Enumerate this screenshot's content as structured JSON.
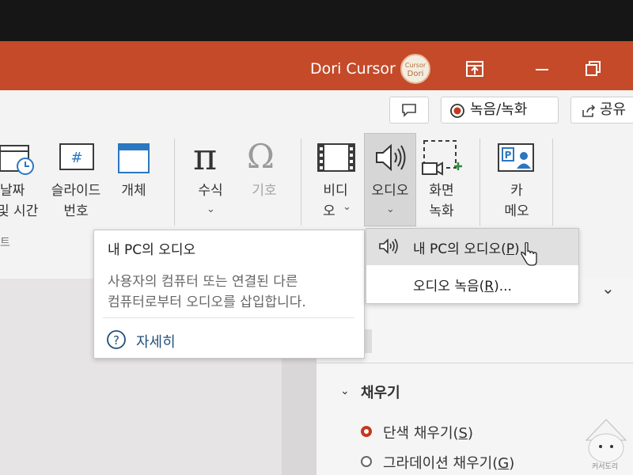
{
  "titlebar": {
    "user_name": "Dori Cursor",
    "avatar_text_line1": "Cursor",
    "avatar_text_line2": "Dori",
    "colors": {
      "titlebar": "#c44a2a",
      "ribbon": "#f3f3f3"
    }
  },
  "ribbon_top": {
    "comment_icon": "comment-icon",
    "record_label": "녹음/녹화",
    "share_label": "공유"
  },
  "ribbon": {
    "datetime": {
      "line1": "날짜",
      "line2": "및 시간"
    },
    "slide_number": {
      "line1": "슬라이드",
      "line2": "번호"
    },
    "object": {
      "label": "개체"
    },
    "equation": {
      "label": "수식"
    },
    "symbol": {
      "label": "기호"
    },
    "video": {
      "line1": "비디",
      "line2": "오"
    },
    "audio": {
      "label": "오디오"
    },
    "screen_recording": {
      "line1": "화면",
      "line2": "녹화"
    },
    "cameo": {
      "line1": "카",
      "line2": "메오"
    },
    "group_label_fragment": "트"
  },
  "tooltip": {
    "title": "내 PC의 오디오",
    "description_line1": "사용자의 컴퓨터 또는 연결된 다른",
    "description_line2": "컴퓨터로부터 오디오를 삽입합니다.",
    "help_label": "자세히"
  },
  "audio_menu": {
    "item1_prefix": "내 PC의 오디오(",
    "item1_key": "P",
    "item1_suffix": ")...",
    "item2_prefix": "오디오 녹음(",
    "item2_key": "R",
    "item2_suffix": ")..."
  },
  "format_pane": {
    "fill_section_title": "채우기",
    "options": [
      {
        "prefix": "단색 채우기(",
        "key": "S",
        "suffix": ")",
        "selected": true
      },
      {
        "prefix": "그라데이션 채우기(",
        "key": "G",
        "suffix": ")",
        "selected": false
      }
    ]
  },
  "watermark": {
    "text": "커서도리"
  }
}
